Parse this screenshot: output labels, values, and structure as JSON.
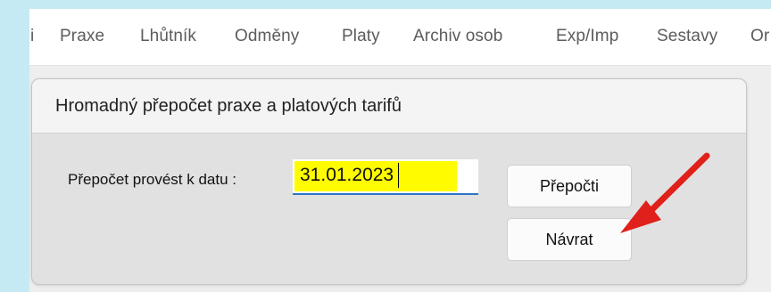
{
  "menubar": {
    "items": [
      "i",
      "Praxe",
      "Lhůtník",
      "Odměny",
      "Platy",
      "Archiv osob",
      "Exp/Imp",
      "Sestavy",
      "Or"
    ]
  },
  "dialog": {
    "title": "Hromadný přepočet praxe a platových tarifů",
    "field_label": "Přepočet provést k datu :",
    "date_value": "31.01.2023",
    "recalc_label": "Přepočti",
    "back_label": "Návrat"
  },
  "annotation": {
    "arrow_color": "#e0201a"
  },
  "colors": {
    "background": "#c6eaf3",
    "highlight": "#fffc00",
    "focus_underline": "#2e72c9"
  }
}
